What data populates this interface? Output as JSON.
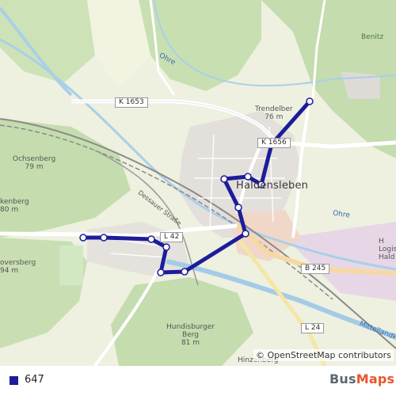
{
  "map": {
    "place_labels": [
      {
        "id": "trendelberg",
        "text": "Trendelber",
        "sub": "76 m"
      },
      {
        "id": "haldensleben",
        "text": "Haldensleben"
      },
      {
        "id": "ochsenberg",
        "text": "Ochsenberg",
        "sub": "79 m"
      },
      {
        "id": "kenberg",
        "text": "kenberg",
        "sub": "80 m"
      },
      {
        "id": "oversberg",
        "text": "oversberg",
        "sub": "94 m"
      },
      {
        "id": "hundisburger",
        "text": "Hundisburger",
        "sub": "Berg",
        "sub2": "81 m"
      },
      {
        "id": "hinzenberg",
        "text": "Hinzenberg"
      },
      {
        "id": "benitz",
        "text": "Benitz"
      },
      {
        "id": "logist",
        "text": "H",
        "sub": "Logist",
        "sub2": "Hald"
      }
    ],
    "water_labels": [
      {
        "id": "ohre-north",
        "text": "Ohre"
      },
      {
        "id": "ohre-east",
        "text": "Ohre"
      },
      {
        "id": "mittellandkanal",
        "text": "Mittellandka"
      }
    ],
    "street_labels": [
      {
        "id": "dessauer-strasse",
        "text": "Dessauer Straße"
      }
    ],
    "road_shields": [
      {
        "id": "k1653",
        "text": "K 1653"
      },
      {
        "id": "k1656",
        "text": "K 1656"
      },
      {
        "id": "l42",
        "text": "L 42"
      },
      {
        "id": "b245",
        "text": "B 245"
      },
      {
        "id": "l24",
        "text": "L 24"
      }
    ],
    "route": {
      "color": "#1c1c9c",
      "stops": 13
    },
    "attribution": "© OpenStreetMap contributors"
  },
  "legend": {
    "line_name": "647",
    "line_color": "#1c1c9c"
  },
  "logo": {
    "part1": "Bus",
    "part2": "Maps"
  }
}
